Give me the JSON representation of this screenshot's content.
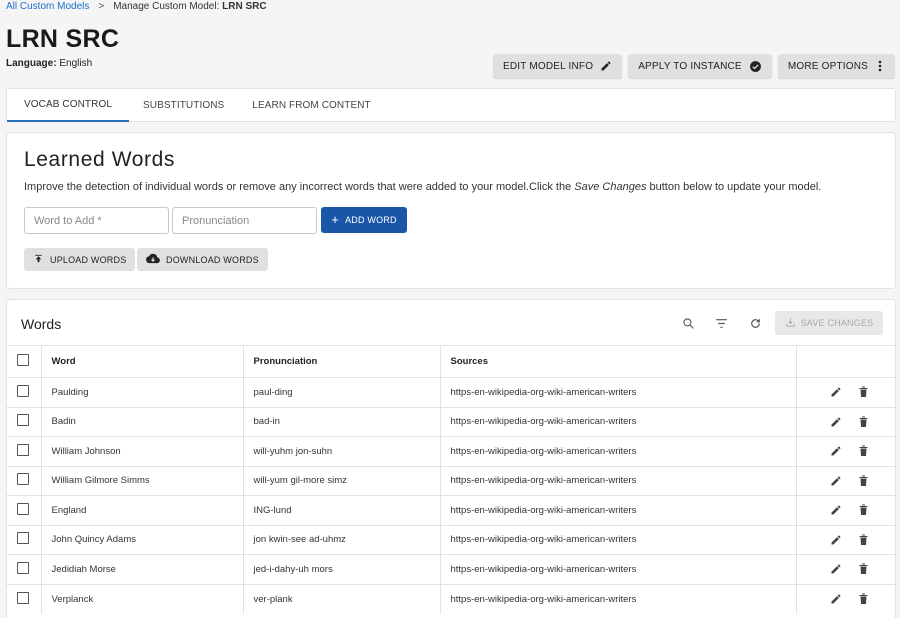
{
  "breadcrumb": {
    "root": "All Custom Models",
    "separator": ">",
    "prefix": "Manage Custom Model: ",
    "current": "LRN SRC"
  },
  "page": {
    "title": "LRN SRC",
    "language_label": "Language:",
    "language_value": "English"
  },
  "header_actions": {
    "edit": "EDIT MODEL INFO",
    "apply": "APPLY TO INSTANCE",
    "more": "MORE OPTIONS"
  },
  "tabs": [
    {
      "label": "VOCAB CONTROL",
      "active": true
    },
    {
      "label": "SUBSTITUTIONS",
      "active": false
    },
    {
      "label": "LEARN FROM CONTENT",
      "active": false
    }
  ],
  "learned": {
    "title": "Learned Words",
    "desc_before": "Improve the detection of individual words or remove any incorrect words that were added to your model.Click the ",
    "desc_italic": "Save Changes",
    "desc_after": " button below to update your model.",
    "word_placeholder": "Word to Add *",
    "pron_placeholder": "Pronunciation",
    "add_word": "ADD WORD",
    "upload": "UPLOAD WORDS",
    "download": "DOWNLOAD WORDS"
  },
  "words": {
    "title": "Words",
    "save_changes": "SAVE CHANGES",
    "columns": [
      "Word",
      "Pronunciation",
      "Sources"
    ],
    "rows": [
      {
        "word": "Paulding",
        "pron": "paul-ding",
        "source": "https-en-wikipedia-org-wiki-american-writers"
      },
      {
        "word": "Badin",
        "pron": "bad-in",
        "source": "https-en-wikipedia-org-wiki-american-writers"
      },
      {
        "word": "William Johnson",
        "pron": "will-yuhm jon-suhn",
        "source": "https-en-wikipedia-org-wiki-american-writers"
      },
      {
        "word": "William Gilmore Simms",
        "pron": "will-yum gil-more simz",
        "source": "https-en-wikipedia-org-wiki-american-writers"
      },
      {
        "word": "England",
        "pron": "ING-lund",
        "source": "https-en-wikipedia-org-wiki-american-writers"
      },
      {
        "word": "John Quincy Adams",
        "pron": "jon kwin-see ad-uhmz",
        "source": "https-en-wikipedia-org-wiki-american-writers"
      },
      {
        "word": "Jedidiah Morse",
        "pron": "jed-i-dahy-uh mors",
        "source": "https-en-wikipedia-org-wiki-american-writers"
      },
      {
        "word": "Verplanck",
        "pron": "ver-plank",
        "source": "https-en-wikipedia-org-wiki-american-writers"
      }
    ]
  },
  "colors": {
    "link": "#1e6fc9",
    "primary_button": "#1a56a8",
    "tab_indicator": "#2b6fbf"
  },
  "icons": [
    "pencil-icon",
    "check-circle-icon",
    "more-vert-icon",
    "plus-icon",
    "upload-icon",
    "cloud-download-icon",
    "search-icon",
    "filter-icon",
    "refresh-icon",
    "save-icon",
    "edit-icon",
    "trash-icon"
  ]
}
